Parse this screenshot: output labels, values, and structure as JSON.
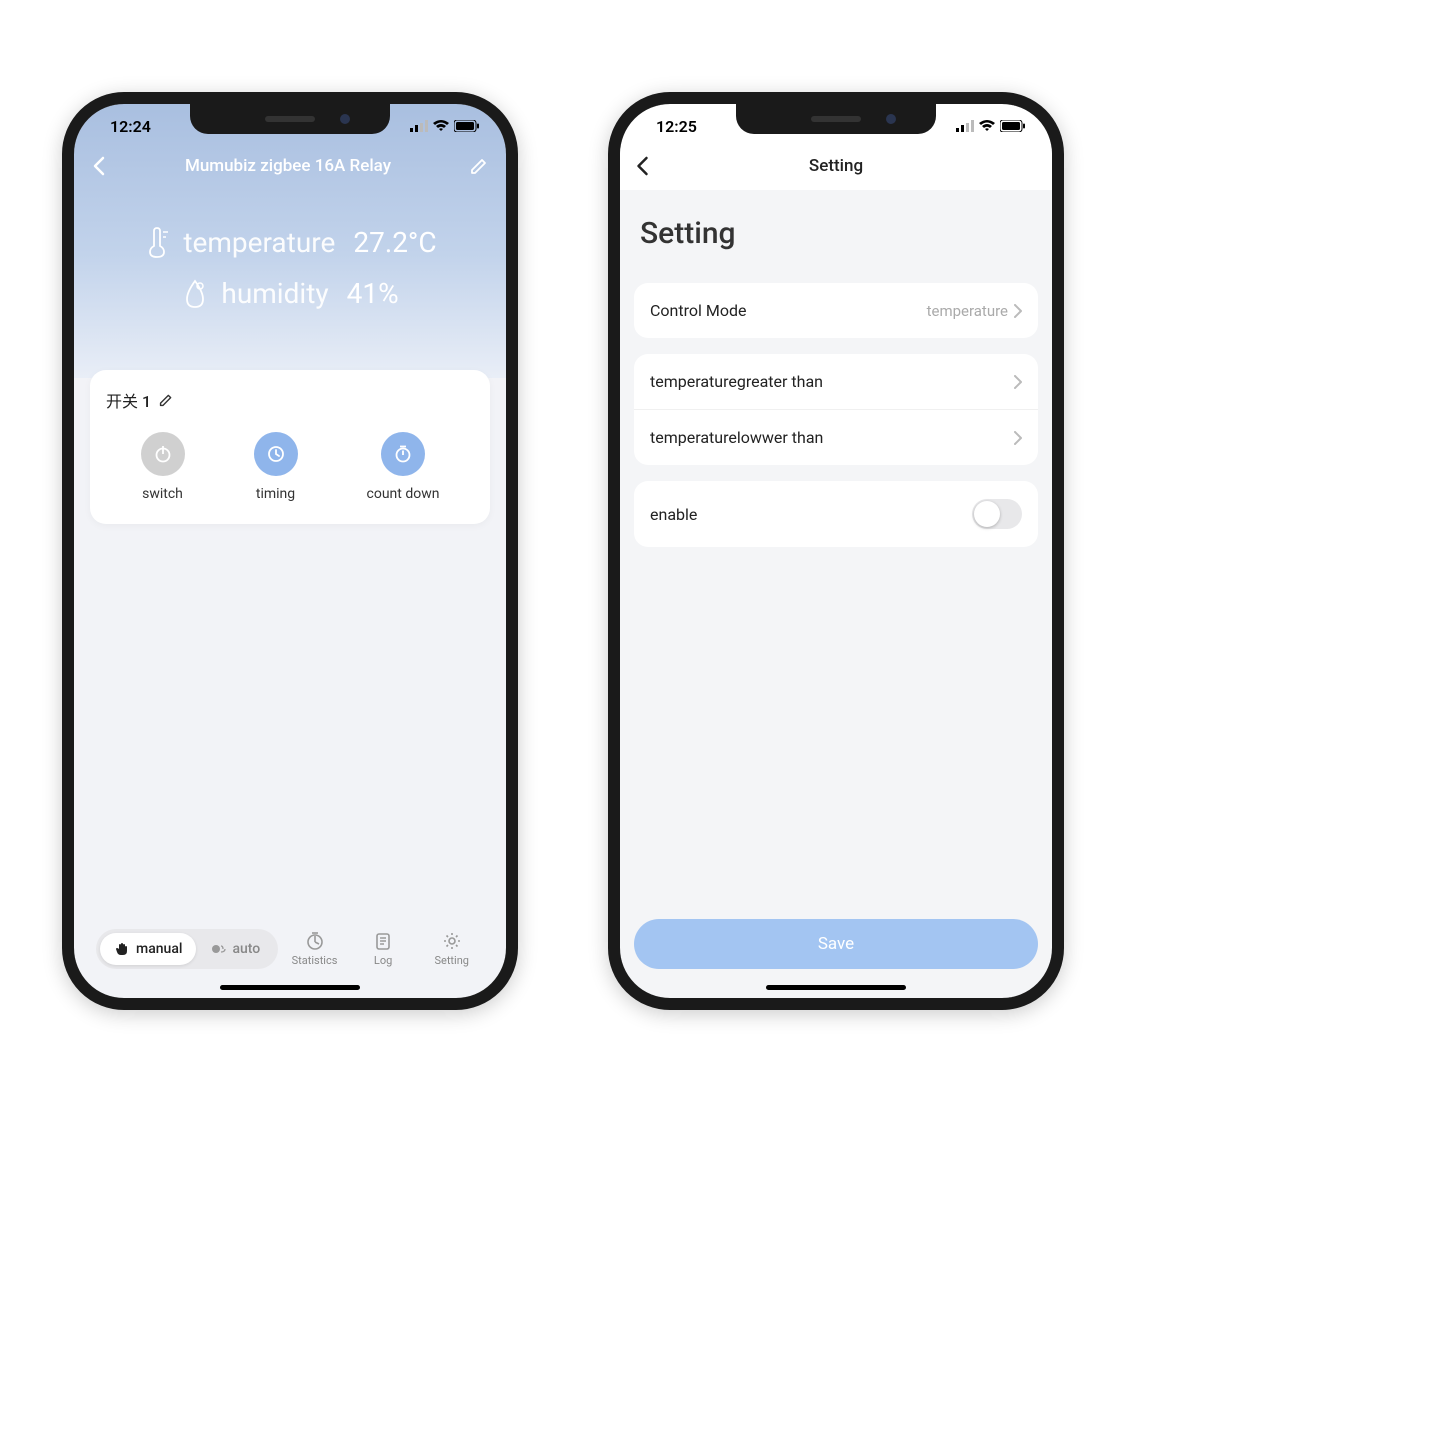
{
  "phone1": {
    "status_time": "12:24",
    "header_title": "Mumubiz zigbee 16A Relay",
    "readings": {
      "temperature_label": "temperature",
      "temperature_value": "27.2°C",
      "humidity_label": "humidity",
      "humidity_value": "41%"
    },
    "card": {
      "title": "开关 1",
      "actions": {
        "switch": "switch",
        "timing": "timing",
        "countdown": "count down"
      }
    },
    "bottom": {
      "manual": "manual",
      "auto": "auto",
      "statistics": "Statistics",
      "log": "Log",
      "setting": "Setting"
    }
  },
  "phone2": {
    "status_time": "12:25",
    "header_title": "Setting",
    "page_heading": "Setting",
    "rows": {
      "control_mode_label": "Control Mode",
      "control_mode_value": "temperature",
      "temp_greater": "temperaturegreater than",
      "temp_lower": "temperaturelowwer than",
      "enable": "enable"
    },
    "save_label": "Save"
  }
}
